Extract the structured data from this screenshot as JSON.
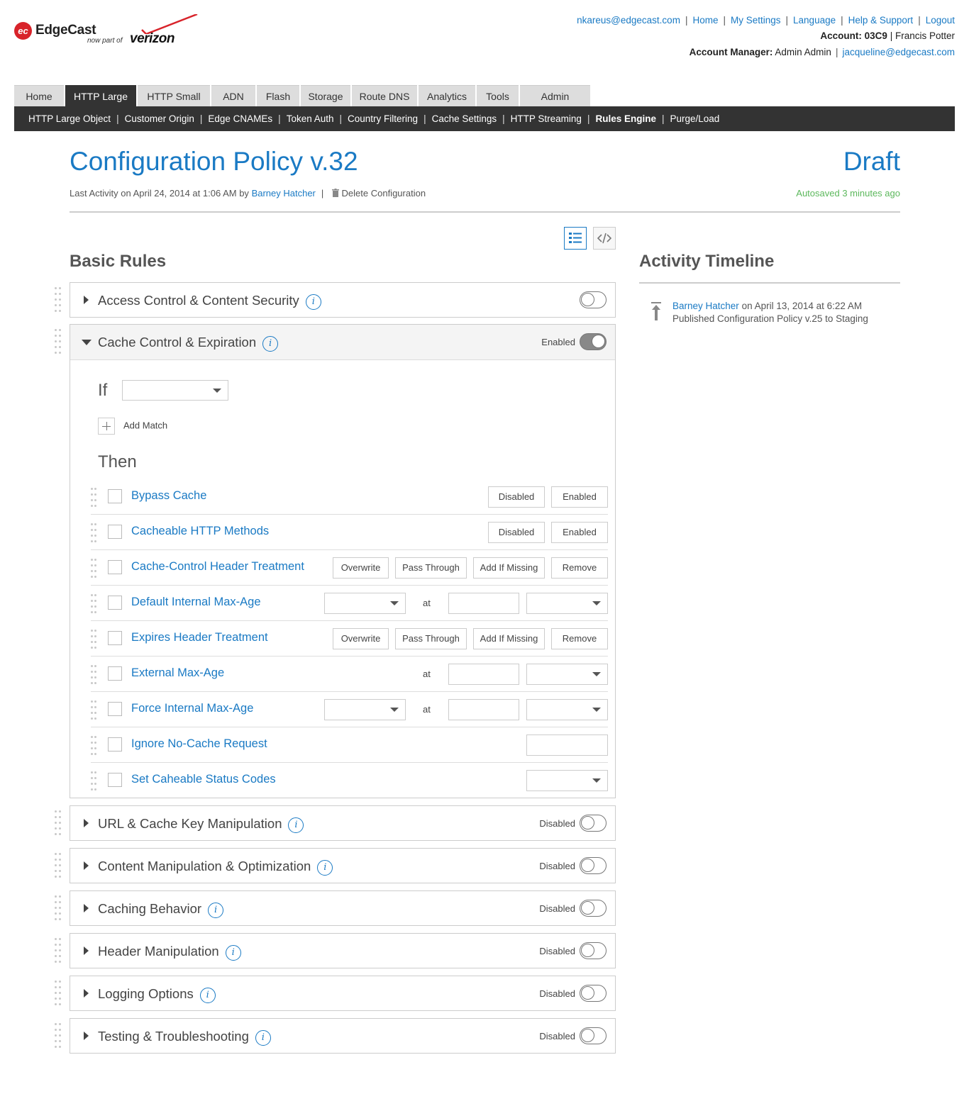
{
  "brand": {
    "logo_mark": "ec",
    "name": "EdgeCast",
    "sub": "now part of",
    "partner": "verizon"
  },
  "toplinks": [
    "nkareus@edgecast.com",
    "Home",
    "My Settings",
    "Language",
    "Help & Support",
    "Logout"
  ],
  "account": {
    "label": "Account:",
    "id": "03C9",
    "sep": "|",
    "name": "Francis Potter"
  },
  "manager": {
    "label": "Account Manager:",
    "name": "Admin Admin",
    "sep": "|",
    "email": "jacqueline@edgecast.com"
  },
  "tabs": [
    "Home",
    "HTTP Large",
    "HTTP Small",
    "ADN",
    "Flash",
    "Storage",
    "Route DNS",
    "Analytics",
    "Tools",
    "Admin"
  ],
  "active_tab": "HTTP Large",
  "subnav": [
    "HTTP Large Object",
    "Customer Origin",
    "Edge CNAMEs",
    "Token Auth",
    "Country Filtering",
    "Cache Settings",
    "HTTP Streaming",
    "Rules Engine",
    "Purge/Load"
  ],
  "active_subnav": "Rules Engine",
  "page": {
    "title": "Configuration Policy v.32",
    "status": "Draft",
    "meta_prefix": "Last Activity on April 24, 2014 at 1:06 AM by",
    "meta_user": "Barney Hatcher",
    "delete_label": "Delete Configuration",
    "autosave": "Autosaved 3 minutes ago"
  },
  "sections": {
    "basic_rules": "Basic Rules",
    "activity": "Activity Timeline"
  },
  "activity": {
    "user": "Barney Hatcher",
    "when": "on April 13, 2014 at 6:22 AM",
    "action": "Published Configuration Policy v.25 to Staging"
  },
  "panels": [
    {
      "title": "Access Control & Content Security",
      "state": "",
      "on": false
    },
    {
      "title": "Cache Control & Expiration",
      "state": "Enabled",
      "on": true
    },
    {
      "title": "URL & Cache Key Manipulation",
      "state": "Disabled",
      "on": false
    },
    {
      "title": "Content Manipulation & Optimization",
      "state": "Disabled",
      "on": false
    },
    {
      "title": "Caching Behavior",
      "state": "Disabled",
      "on": false
    },
    {
      "title": "Header Manipulation",
      "state": "Disabled",
      "on": false
    },
    {
      "title": "Logging Options",
      "state": "Disabled",
      "on": false
    },
    {
      "title": "Testing & Troubleshooting",
      "state": "Disabled",
      "on": false
    }
  ],
  "rule_editor": {
    "if_label": "If",
    "add_match": "Add Match",
    "then_label": "Then",
    "at_label": "at",
    "rules": [
      {
        "label": "Bypass Cache",
        "buttons": [
          "Disabled",
          "Enabled"
        ]
      },
      {
        "label": "Cacheable HTTP Methods",
        "buttons": [
          "Disabled",
          "Enabled"
        ]
      },
      {
        "label": "Cache-Control Header Treatment",
        "buttons": [
          "Overwrite",
          "Pass Through",
          "Add If Missing",
          "Remove"
        ]
      },
      {
        "label": "Default Internal Max-Age"
      },
      {
        "label": "Expires Header Treatment",
        "buttons": [
          "Overwrite",
          "Pass Through",
          "Add If Missing",
          "Remove"
        ]
      },
      {
        "label": "External Max-Age"
      },
      {
        "label": "Force Internal Max-Age"
      },
      {
        "label": "Ignore No-Cache Request"
      },
      {
        "label": "Set Caheable Status Codes"
      }
    ]
  },
  "icons": {
    "info": "i",
    "view_list": "list-view-icon",
    "view_code": "code-view-icon",
    "trash": "trash-icon",
    "publish": "publish-arrow-icon"
  }
}
